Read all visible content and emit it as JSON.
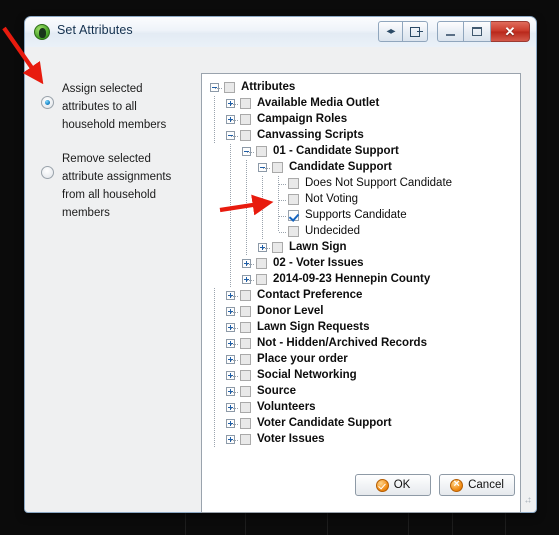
{
  "window": {
    "title": "Set Attributes",
    "icon": "app-globe-icon",
    "buttons": {
      "expand_collapse": "◀▶",
      "panel": "panel-icon",
      "minimize": "minimize-icon",
      "maximize": "maximize-icon",
      "close": "✕"
    }
  },
  "options": {
    "selected_index": 0,
    "items": [
      {
        "label": "Assign selected attributes to all household members",
        "selected": true
      },
      {
        "label": "Remove selected attribute assignments from all household members",
        "selected": false
      }
    ]
  },
  "tree": {
    "nodes": [
      {
        "label": "Attributes",
        "depth": 0,
        "toggle": "minus",
        "checkbox": "unchecked",
        "bold": true
      },
      {
        "label": "Available Media Outlet",
        "depth": 1,
        "toggle": "plus",
        "checkbox": "unchecked",
        "bold": true
      },
      {
        "label": "Campaign Roles",
        "depth": 1,
        "toggle": "plus",
        "checkbox": "unchecked",
        "bold": true
      },
      {
        "label": "Canvassing Scripts",
        "depth": 1,
        "toggle": "minus",
        "checkbox": "unchecked",
        "bold": true
      },
      {
        "label": "01 - Candidate Support",
        "depth": 2,
        "toggle": "minus",
        "checkbox": "unchecked",
        "bold": true
      },
      {
        "label": "Candidate Support",
        "depth": 3,
        "toggle": "minus",
        "checkbox": "unchecked",
        "bold": true
      },
      {
        "label": "Does Not Support Candidate",
        "depth": 4,
        "toggle": "none",
        "checkbox": "unchecked",
        "bold": false
      },
      {
        "label": "Not Voting",
        "depth": 4,
        "toggle": "none",
        "checkbox": "unchecked",
        "bold": false
      },
      {
        "label": "Supports Candidate",
        "depth": 4,
        "toggle": "none",
        "checkbox": "checked",
        "bold": false
      },
      {
        "label": "Undecided",
        "depth": 4,
        "toggle": "none",
        "checkbox": "unchecked",
        "bold": false
      },
      {
        "label": "Lawn Sign",
        "depth": 3,
        "toggle": "plus",
        "checkbox": "unchecked",
        "bold": true
      },
      {
        "label": "02 - Voter Issues",
        "depth": 2,
        "toggle": "plus",
        "checkbox": "unchecked",
        "bold": true
      },
      {
        "label": "2014-09-23 Hennepin County",
        "depth": 2,
        "toggle": "plus",
        "checkbox": "unchecked",
        "bold": true
      },
      {
        "label": "Contact Preference",
        "depth": 1,
        "toggle": "plus",
        "checkbox": "unchecked",
        "bold": true
      },
      {
        "label": "Donor Level",
        "depth": 1,
        "toggle": "plus",
        "checkbox": "unchecked",
        "bold": true
      },
      {
        "label": "Lawn Sign Requests",
        "depth": 1,
        "toggle": "plus",
        "checkbox": "unchecked",
        "bold": true
      },
      {
        "label": "Not - Hidden/Archived Records",
        "depth": 1,
        "toggle": "plus",
        "checkbox": "unchecked",
        "bold": true
      },
      {
        "label": "Place your order",
        "depth": 1,
        "toggle": "plus",
        "checkbox": "unchecked",
        "bold": true
      },
      {
        "label": "Social Networking",
        "depth": 1,
        "toggle": "plus",
        "checkbox": "unchecked",
        "bold": true
      },
      {
        "label": "Source",
        "depth": 1,
        "toggle": "plus",
        "checkbox": "unchecked",
        "bold": true
      },
      {
        "label": "Volunteers",
        "depth": 1,
        "toggle": "plus",
        "checkbox": "unchecked",
        "bold": true
      },
      {
        "label": "Voter Candidate Support",
        "depth": 1,
        "toggle": "plus",
        "checkbox": "unchecked",
        "bold": true
      },
      {
        "label": "Voter Issues",
        "depth": 1,
        "toggle": "plus",
        "checkbox": "unchecked",
        "bold": true
      }
    ]
  },
  "footer": {
    "ok_label": "OK",
    "cancel_label": "Cancel"
  },
  "annotations": {
    "arrow_color": "#e81b0e",
    "arrows": [
      {
        "name": "arrow-to-assign-radio",
        "target": "assign-radio"
      },
      {
        "name": "arrow-to-supports-candidate-checkbox",
        "target": "supports-candidate-checkbox"
      }
    ]
  }
}
